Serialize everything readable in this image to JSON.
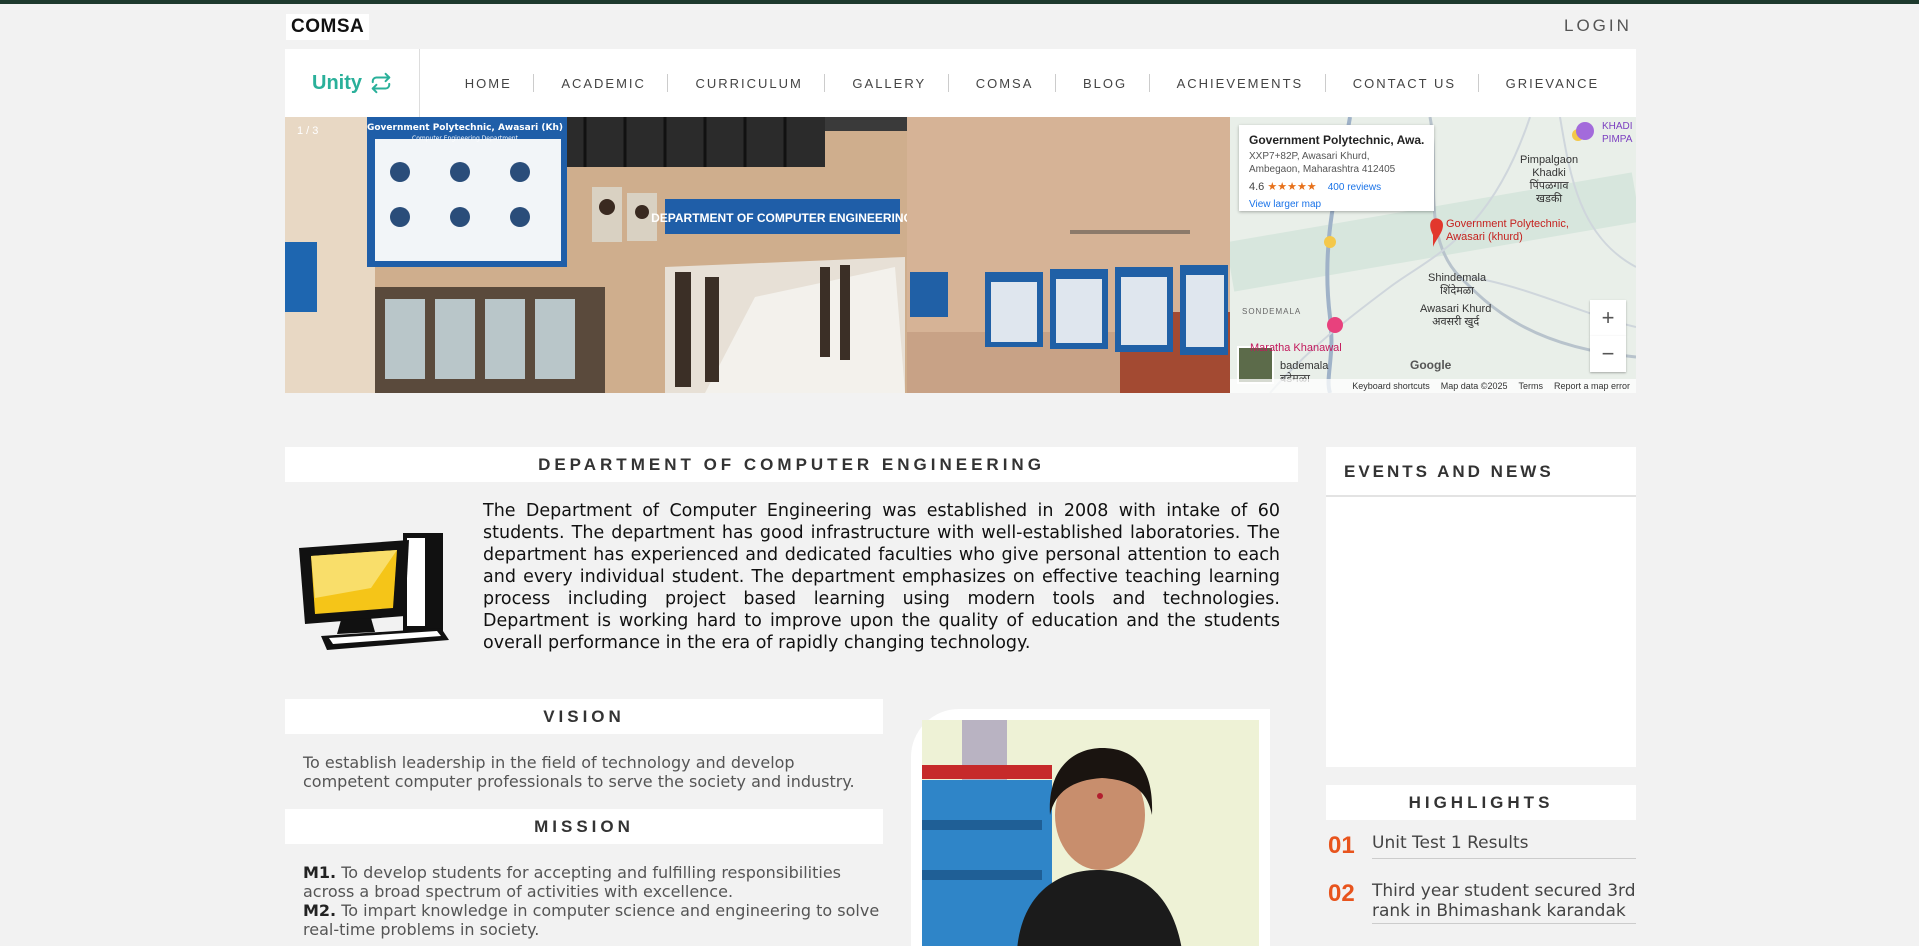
{
  "header": {
    "logo_text": "COMSA",
    "login_label": "LOGIN"
  },
  "nav": {
    "brand": "Unity",
    "items": [
      "HOME",
      "ACADEMIC",
      "CURRICULUM",
      "GALLERY",
      "COMSA",
      "BLOG",
      "ACHIEVEMENTS",
      "CONTACT US",
      "GRIEVANCE"
    ]
  },
  "slider": {
    "counter": "1 / 3",
    "sign_text": "DEPARTMENT OF COMPUTER ENGINEERING",
    "board_title": "Government Polytechnic, Awasari (Kh)",
    "board_subtitle": "Computer Engineering Department"
  },
  "map": {
    "place_title": "Government Polytechnic, Awa...",
    "address_line1": "XXP7+82P, Awasari Khurd,",
    "address_line2": "Ambegaon, Maharashtra 412405",
    "rating": "4.6",
    "stars": "★★★★★",
    "reviews": "400 reviews",
    "larger_map": "View larger map",
    "labels": {
      "pimpalgaon": "Pimpalgaon\nKhadki\nपिंपळगाव\nखडकी",
      "marker": "Government Polytechnic,\nAwasari (khurd)",
      "shindemala": "Shindemala\nशिंदेमळा",
      "awasari": "Awasari Khurd\nअवसरी खुर्द",
      "sondemala": "SONDEMALA",
      "maratha": "Maratha Khanawal",
      "bodemala": "bademala\nबडेमळा",
      "khadi": "KHADI\nPIMPA"
    },
    "zoom_in": "+",
    "zoom_out": "−",
    "footer": [
      "Keyboard shortcuts",
      "Map data ©2025",
      "Terms",
      "Report a map error"
    ],
    "google": "Google"
  },
  "department": {
    "title": "DEPARTMENT OF COMPUTER ENGINEERING",
    "description": "The Department of Computer Engineering was established in 2008 with intake of 60 students. The department has good infrastructure with well-established laboratories. The department has experienced and dedicated faculties who give personal attention to each and every individual student. The department emphasizes on effective teaching learning process including project based learning using modern tools and technologies. Department is working hard to improve upon the quality of education and the students overall performance in the era of rapidly changing technology."
  },
  "vision": {
    "title": "VISION",
    "text": "To establish leadership in the field of technology and develop competent computer professionals to serve the society and industry."
  },
  "mission": {
    "title": "MISSION",
    "items": [
      {
        "label": "M1.",
        "text": "To develop students for accepting and fulfilling responsibilities across a broad spectrum of activities with excellence."
      },
      {
        "label": "M2.",
        "text": "To impart knowledge in computer science and engineering to solve real-time problems in society."
      }
    ]
  },
  "events": {
    "title": "EVENTS AND NEWS"
  },
  "highlights": {
    "title": "HIGHLIGHTS",
    "items": [
      {
        "num": "01",
        "text": "Unit Test 1 Results"
      },
      {
        "num": "02",
        "text": "Third year student secured 3rd rank in Bhimashank karandak"
      }
    ]
  },
  "colors": {
    "brand": "#2ab09a",
    "accent": "#e8541d",
    "topbar": "#1e3a2e"
  }
}
